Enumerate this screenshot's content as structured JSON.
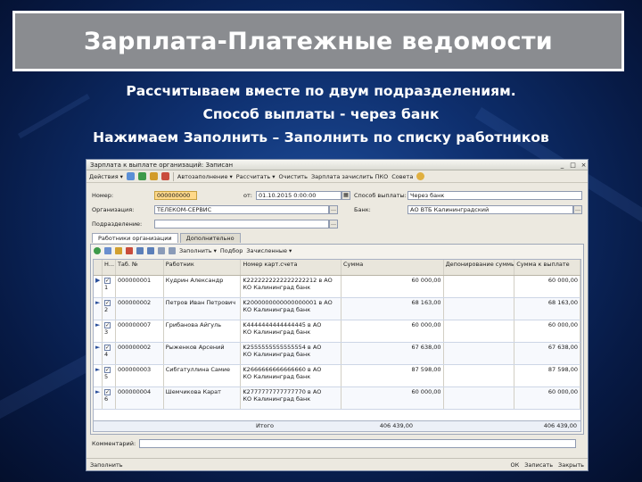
{
  "slide": {
    "title": "Зарплата-Платежные ведомости",
    "lines": [
      "Рассчитываем вместе по двум подразделениям.",
      "Способ выплаты - через банк",
      "Нажимаем Заполнить – Заполнить по списку работников"
    ]
  },
  "window": {
    "title": "Зарплата к выплате организаций: Записан",
    "toolbar": [
      "Действия",
      "Автозаполнение",
      "Рассчитать",
      "Очистить",
      "Зарплата зачислить ПКО",
      "Совета"
    ],
    "fields": {
      "number_label": "Номер:",
      "number_value": "000000000",
      "date_label": "от:",
      "date_value": "01.10.2015 0:00:00",
      "payment_label": "Способ выплаты:",
      "payment_value": "Через банк",
      "org_label": "Организация:",
      "org_value": "ТЕЛЕКОМ-СЕРВИС",
      "bank_label": "Банк:",
      "bank_value": "АО ВТБ Калининградский",
      "dept_label": "Подразделение:",
      "dept_value": ""
    },
    "tabs": [
      "Работники организации",
      "Дополнительно"
    ],
    "panel_toolbar": [
      "Заполнить",
      "Подбор",
      "Зачисленные"
    ],
    "columns": [
      "Н...",
      "Таб. №",
      "Работник",
      "Номер карт.счета",
      "Сумма",
      "Депонирование суммы",
      "Сумма к выплате"
    ],
    "rows": [
      {
        "n": "1",
        "tab": "000000001",
        "name": "Кудрин Александр",
        "card": "K2222222222222222212 в АО",
        "bank": "КО Калининград банк",
        "sum": "60 000,00",
        "payout": "60 000,00"
      },
      {
        "n": "2",
        "tab": "000000002",
        "name": "Петров Иван Петрович",
        "card": "K2000000000000000001 в АО",
        "bank": "КО Калининград банк",
        "sum": "68 163,00",
        "payout": "68 163,00"
      },
      {
        "n": "3",
        "tab": "000000007",
        "name": "Грибанова Айгуль",
        "card": "K4444444444444445 в АО",
        "bank": "КО Калининград банк",
        "sum": "60 000,00",
        "payout": "60 000,00"
      },
      {
        "n": "4",
        "tab": "000000002",
        "name": "Рыженков Арсений",
        "card": "K2555555555555554 в АО",
        "bank": "КО Калининград банк",
        "sum": "67 638,00",
        "payout": "67 638,00"
      },
      {
        "n": "5",
        "tab": "000000003",
        "name": "Сибгатуллина Самие",
        "card": "K2666666666666660 в АО",
        "bank": "КО Калининград банк",
        "sum": "87 598,00",
        "payout": "87 598,00"
      },
      {
        "n": "6",
        "tab": "000000004",
        "name": "Шемчикова Карат",
        "card": "K2777777777777770 в АО",
        "bank": "КО Калининград банк",
        "sum": "60 000,00",
        "payout": "60 000,00"
      }
    ],
    "total_label": "Итого",
    "total_sum": "406 439,00",
    "total_payout": "406 439,00",
    "comment_label": "Комментарий:",
    "status_left": "Заполнить",
    "status_buttons": [
      "ОК",
      "Записать",
      "Закрыть"
    ]
  }
}
